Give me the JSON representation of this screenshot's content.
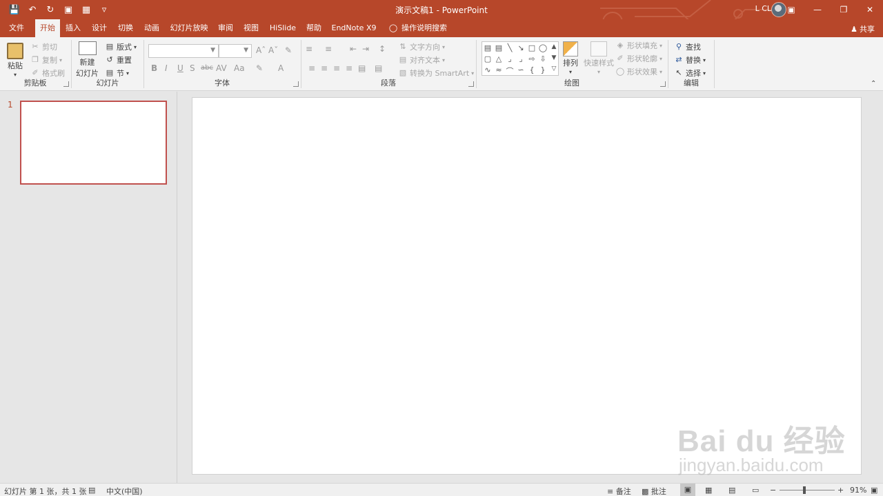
{
  "window": {
    "title": "演示文稿1 - PowerPoint",
    "user": "L CL"
  },
  "tabs": [
    {
      "label": "文件"
    },
    {
      "label": "开始"
    },
    {
      "label": "插入"
    },
    {
      "label": "设计"
    },
    {
      "label": "切换"
    },
    {
      "label": "动画"
    },
    {
      "label": "幻灯片放映"
    },
    {
      "label": "审阅"
    },
    {
      "label": "视图"
    },
    {
      "label": "HiSlide"
    },
    {
      "label": "帮助"
    },
    {
      "label": "EndNote X9"
    }
  ],
  "active_tab": "开始",
  "tell_me": "操作说明搜索",
  "share": "共享",
  "ribbon": {
    "clipboard": {
      "label": "剪贴板",
      "paste": "粘贴",
      "cut": "剪切",
      "copy": "复制",
      "format_painter": "格式刷"
    },
    "slides": {
      "label": "幻灯片",
      "new_slide_1": "新建",
      "new_slide_2": "幻灯片",
      "layout": "版式",
      "reset": "重置",
      "section": "节"
    },
    "font": {
      "label": "字体"
    },
    "paragraph": {
      "label": "段落",
      "text_direction": "文字方向",
      "align_text": "对齐文本",
      "convert_smartart": "转换为 SmartArt"
    },
    "drawing": {
      "label": "绘图",
      "arrange": "排列",
      "quick_styles": "快速样式",
      "shape_fill": "形状填充",
      "shape_outline": "形状轮廓",
      "shape_effects": "形状效果"
    },
    "editing": {
      "label": "编辑",
      "find": "查找",
      "replace": "替换",
      "select": "选择"
    }
  },
  "slides_pane": {
    "slide_number": "1"
  },
  "statusbar": {
    "slide_info": "幻灯片 第 1 张，共 1 张",
    "language": "中文(中国)",
    "notes": "备注",
    "comments": "批注",
    "zoom": "91%"
  },
  "watermark": {
    "line1": "Bai du 经验",
    "line2": "jingyan.baidu.com"
  },
  "colors": {
    "accent": "#b7472a",
    "slide_border": "#c0504d"
  }
}
